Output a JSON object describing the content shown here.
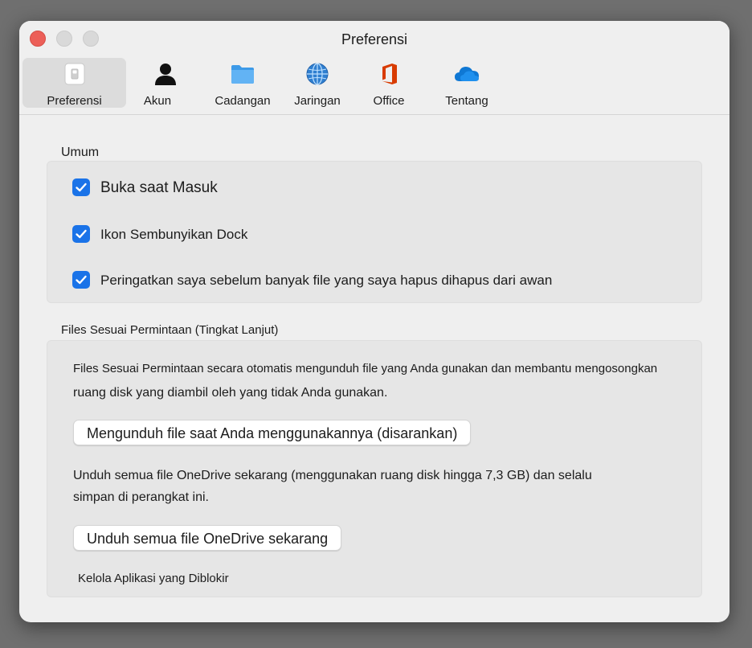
{
  "window": {
    "title": "Preferensi"
  },
  "tabs": [
    {
      "label": "Preferensi",
      "icon": "switch-icon"
    },
    {
      "label": "Akun",
      "icon": "person-icon"
    },
    {
      "label": "Cadangan",
      "icon": "folder-icon"
    },
    {
      "label": "Jaringan",
      "icon": "globe-icon"
    },
    {
      "label": "Office",
      "icon": "office-icon"
    },
    {
      "label": "Tentang",
      "icon": "cloud-icon"
    }
  ],
  "general": {
    "heading": "Umum",
    "options": [
      {
        "label": "Buka saat Masuk",
        "checked": true
      },
      {
        "label": "Ikon Sembunyikan Dock",
        "checked": true
      },
      {
        "label": "Peringatkan saya sebelum banyak file yang saya hapus dihapus dari awan",
        "checked": true
      }
    ]
  },
  "files_on_demand": {
    "heading": "Files Sesuai Permintaan (Tingkat Lanjut)",
    "description_line1": "Files Sesuai Permintaan secara otomatis mengunduh file yang Anda gunakan dan membantu mengosongkan",
    "description_line2": "ruang disk yang diambil oleh yang tidak Anda gunakan.",
    "download_on_use_button": "Mengunduh file saat Anda menggunakannya (disarankan)",
    "download_all_desc_line1": "Unduh semua file OneDrive sekarang (menggunakan ruang disk hingga 7,3 GB) dan selalu",
    "download_all_desc_line2": "simpan di perangkat ini.",
    "download_all_button": "Unduh semua file OneDrive sekarang",
    "manage_blocked_apps": "Kelola Aplikasi yang Diblokir"
  },
  "colors": {
    "accent": "#1a73e8",
    "close": "#ec5f58",
    "office": "#d83b01",
    "onedrive": "#0f78d4"
  }
}
